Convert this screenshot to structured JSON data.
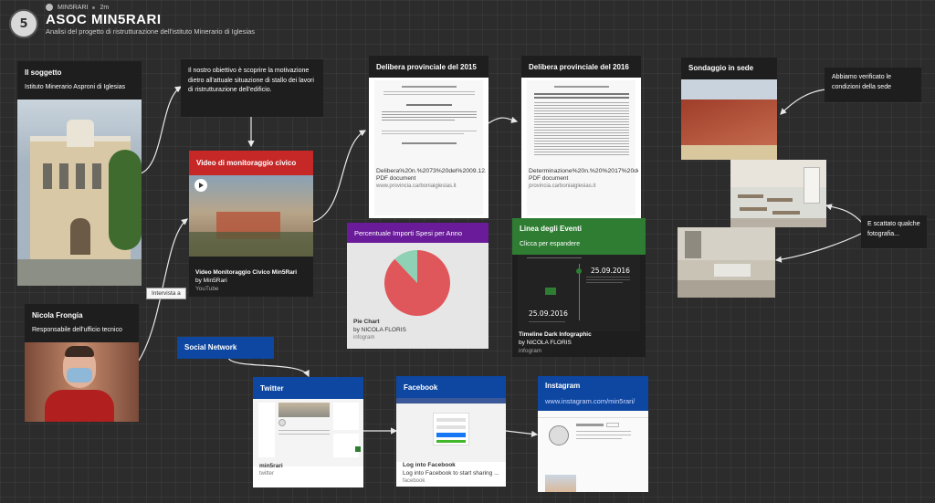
{
  "header": {
    "user": "MIN5RARI",
    "time": "2m",
    "title": "ASOC MIN5RARI",
    "subtitle": "Analisi del progetto di ristrutturazione dell'istituto Minerario di Iglesias",
    "avatar_text": "5"
  },
  "soggetto": {
    "title": "Il soggetto",
    "text": "Istituto Minerario Asproni di Iglesias"
  },
  "obiettivo": {
    "text": "Il nostro obiettivo è scoprire la motivazione dietro all'attuale situazione di stallo dei lavori di ristrutturazione dell'edificio."
  },
  "video": {
    "header": "Video di monitoraggio civico",
    "title": "Video Monitoraggio Civico Min5Rari",
    "author": "by Min5Rari",
    "source": "YouTube"
  },
  "delibera2015": {
    "title": "Delibera provinciale del 2015",
    "file": "Delibera%20n.%2073%20del%2009.12...",
    "type": "PDF document",
    "url": "www.provincia.carboniaiglesias.it"
  },
  "delibera2016": {
    "title": "Delibera provinciale del 2016",
    "file": "Determinazione%20n.%20%2017%20del...",
    "type": "PDF document",
    "url": "provincia.carboniaiglesias.it"
  },
  "sondaggio": {
    "title": "Sondaggio in sede"
  },
  "verificato": {
    "text": "Abbiamo verificato le condizioni della sede"
  },
  "scattato": {
    "text": "E scattato qualche fotografia..."
  },
  "percentuale": {
    "header": "Percentuale Importi Spesi per Anno",
    "title": "Pie Chart",
    "author": "by NICOLA FLORIS",
    "source": "infogram"
  },
  "eventi": {
    "header": "Linea degli Eventi",
    "sub": "Clicca per espandere",
    "date1": "25.09.2016",
    "date2": "25.09.2016",
    "title": "Timeline Dark Infographic",
    "author": "by NICOLA FLORIS",
    "source": "infogram"
  },
  "nicola": {
    "title": "Nicola Frongia",
    "text": "Responsabile dell'ufficio tecnico"
  },
  "intervista": {
    "label": "Intervista a"
  },
  "social": {
    "label": "Social Network"
  },
  "twitter": {
    "header": "Twitter",
    "title": "min5rari",
    "source": "twitter"
  },
  "facebook": {
    "header": "Facebook",
    "title": "Log into Facebook",
    "desc": "Log into Facebook to start sharing ...",
    "source": "facebook"
  },
  "instagram": {
    "header": "Instagram",
    "url": "www.instagram.com/min5rari/"
  },
  "colors": {
    "red": "#c62828",
    "purple": "#6a1b9a",
    "green": "#2e7d32",
    "blue": "#0d47a1",
    "background": "#2c2c2c"
  },
  "chart_data": {
    "type": "pie",
    "title": "",
    "slices": [
      {
        "name": "",
        "value": 88,
        "color": "#e0575b"
      },
      {
        "name": "",
        "value": 12,
        "color": "#8fd1b4"
      }
    ]
  }
}
